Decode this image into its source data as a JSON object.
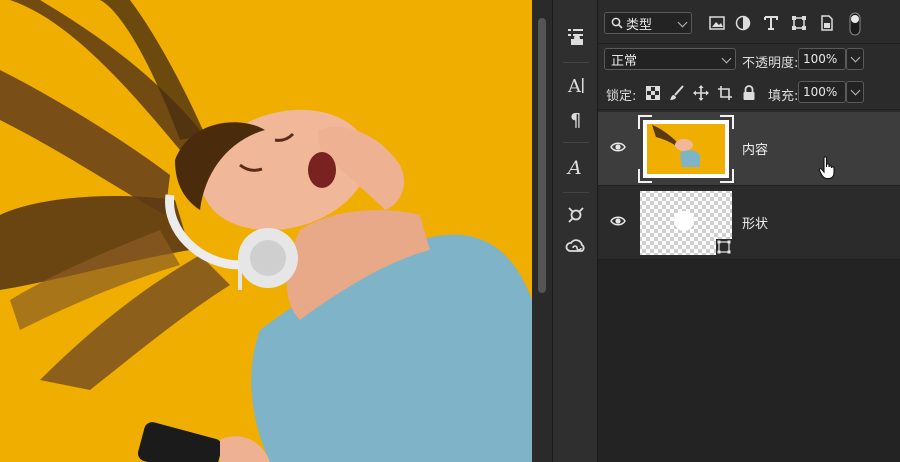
{
  "layers_panel": {
    "filter": {
      "label": "类型",
      "icons": [
        "pixel-filter-icon",
        "adjustment-filter-icon",
        "type-filter-icon",
        "shape-filter-icon",
        "smart-object-filter-icon",
        "filter-toggle-icon"
      ]
    },
    "blend_mode": "正常",
    "opacity_label": "不透明度:",
    "opacity_value": "100%",
    "lock_label": "锁定:",
    "lock_icons": [
      "lock-transparent-icon",
      "lock-image-icon",
      "lock-position-icon",
      "lock-artboard-icon",
      "lock-all-icon"
    ],
    "fill_label": "填充:",
    "fill_value": "100%",
    "layers": [
      {
        "name": "内容",
        "visible": true,
        "selected": true
      },
      {
        "name": "形状",
        "visible": true,
        "selected": false
      }
    ]
  },
  "tool_strip": {
    "icons": [
      "properties-icon",
      "character-icon",
      "paragraph-icon",
      "glyphs-icon",
      "libraries-icon",
      "creative-cloud-icon"
    ]
  },
  "colors": {
    "canvas_background": "#efae00",
    "shirt": "#7fb3c8",
    "panel": "#2b2b2b",
    "selected_layer": "#3d3d3d"
  }
}
